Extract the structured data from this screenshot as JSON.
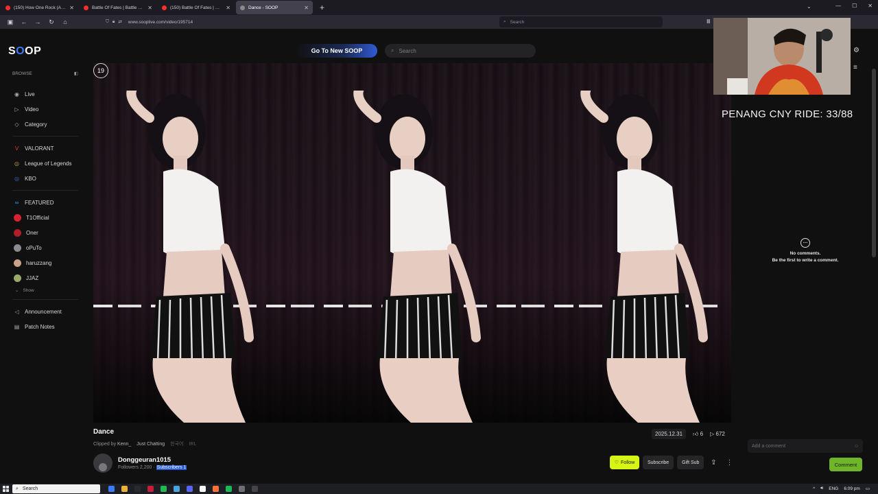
{
  "browser": {
    "tabs": [
      {
        "label": "(150) How One Rock (Almost) F...",
        "active": false
      },
      {
        "label": "Battle Of Fates | Battle Trail...",
        "active": false
      },
      {
        "label": "(150) Battle Of Fates | Batt...",
        "active": false
      },
      {
        "label": "Dance - SOOP",
        "active": true
      }
    ],
    "url": "www.sooplive.com/video/195714",
    "search_placeholder": "Search"
  },
  "header": {
    "logo": "SOOP",
    "go_new_label": "Go To New SOOP",
    "search_placeholder": "Search"
  },
  "sidebar": {
    "browse_label": "BROWSE",
    "items": [
      {
        "label": "Live",
        "icon": "live-icon"
      },
      {
        "label": "Video",
        "icon": "video-icon"
      },
      {
        "label": "Category",
        "icon": "category-icon"
      }
    ],
    "games": [
      {
        "label": "VALORANT",
        "color": "#e0304b"
      },
      {
        "label": "League of Legends",
        "color": "#c8a24a"
      },
      {
        "label": "KBO",
        "color": "#3a6cc8"
      }
    ],
    "featured_label": "FEATURED",
    "featured": [
      {
        "label": "T1Official",
        "color": "#d6222f"
      },
      {
        "label": "Oner",
        "color": "#b01e2a"
      },
      {
        "label": "oPuTo",
        "color": "#8a8a90"
      },
      {
        "label": "haruzzang",
        "color": "#c9a28a"
      },
      {
        "label": "JJAZ",
        "color": "#9ba86c"
      }
    ],
    "show_label": "Show",
    "bottom": [
      {
        "label": "Announcement",
        "icon": "megaphone-icon"
      },
      {
        "label": "Patch Notes",
        "icon": "notes-icon"
      }
    ]
  },
  "video": {
    "counter": "19",
    "title": "Dance",
    "clipped_by_label": "Clipped by",
    "clipped_by_user": "Kenn_",
    "category": "Just Chatting",
    "tag1": "한국어",
    "tag2": "IRL",
    "date": "2025.12.31",
    "likes": "6",
    "views": "672"
  },
  "channel": {
    "name": "Donggeuran1015",
    "followers_label": "Followers 2,200 ·",
    "subscribers_label": "Subscribers 1",
    "follow_label": "Follow",
    "subscribe_label": "Subscribe",
    "gift_label": "Gift Sub"
  },
  "comments": {
    "empty_title": "No comments.",
    "empty_sub": "Be the first to write a comment.",
    "input_placeholder": "Add a comment",
    "submit_label": "Comment"
  },
  "overlay": {
    "ride_text": "PENANG CNY RIDE: 33/88"
  },
  "taskbar": {
    "search_placeholder": "Search",
    "lang": "ENG",
    "time": "6:09 pm"
  }
}
